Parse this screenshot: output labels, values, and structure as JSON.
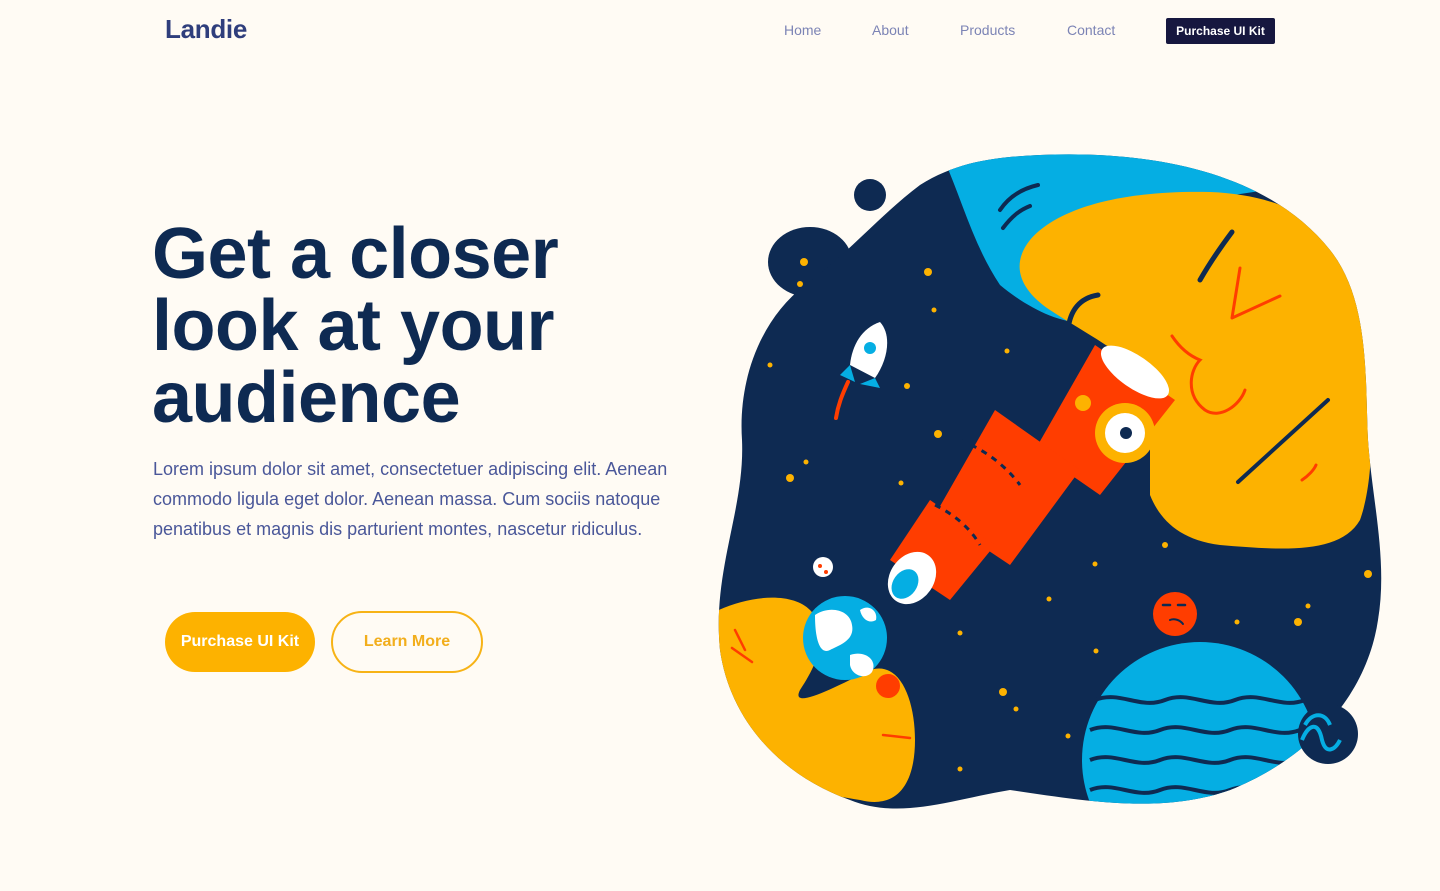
{
  "header": {
    "logo": "Landie",
    "nav": [
      "Home",
      "About",
      "Products",
      "Contact"
    ],
    "cta_label": "Purchase UI Kit"
  },
  "hero": {
    "headline_lines": [
      "Get a closer",
      "look at your",
      "audience"
    ],
    "subtext": "Lorem ipsum dolor sit amet, consectetuer adipiscing elit. Aenean commodo ligula eget dolor. Aenean massa. Cum sociis natoque penatibus et magnis dis parturient montes, nascetur ridiculus.",
    "primary_button": "Purchase UI Kit",
    "secondary_button": "Learn More"
  },
  "illustration": {
    "icon": "space-telescope-illustration"
  },
  "colors": {
    "background": "#FFFBF4",
    "headline": "#0E2A52",
    "accent_yellow": "#FDB200",
    "nav_button": "#16173F",
    "space_navy": "#0E2A52",
    "sky_blue": "#05AEE3",
    "telescope_red": "#FF3D00"
  }
}
